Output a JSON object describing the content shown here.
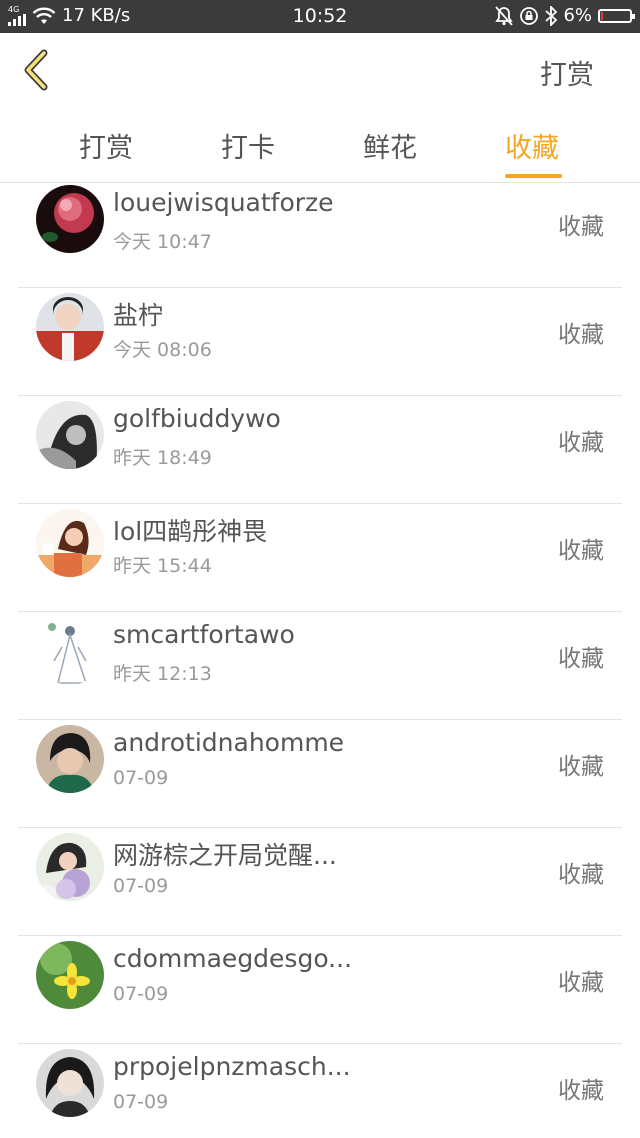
{
  "status_bar": {
    "network_type": "4G",
    "speed": "17 KB/s",
    "time": "10:52",
    "battery_text": "6%",
    "battery_level": 0.06,
    "battery_color": "#e53935"
  },
  "header": {
    "back_icon": "chevron-left-icon",
    "action_label": "打赏"
  },
  "tabs": [
    {
      "label": "打赏",
      "active": false
    },
    {
      "label": "打卡",
      "active": false
    },
    {
      "label": "鲜花",
      "active": false
    },
    {
      "label": "收藏",
      "active": true
    }
  ],
  "accent_color": "#f5a623",
  "items": [
    {
      "name": "louejwisquatforze",
      "time": "今天 10:47",
      "action": "收藏"
    },
    {
      "name": "盐柠",
      "time": "今天 08:06",
      "action": "收藏"
    },
    {
      "name": "golfbiuddywo",
      "time": "昨天 18:49",
      "action": "收藏"
    },
    {
      "name": "lol四鹋彤神畏",
      "time": "昨天 15:44",
      "action": "收藏"
    },
    {
      "name": "smcartfortawo",
      "time": "昨天 12:13",
      "action": "收藏"
    },
    {
      "name": "androtidnahomme",
      "time": "07-09",
      "action": "收藏"
    },
    {
      "name": "网游棕之开局觉醒...",
      "time": "07-09",
      "action": "收藏"
    },
    {
      "name": "cdommaegdesgo...",
      "time": "07-09",
      "action": "收藏"
    },
    {
      "name": "prpojelpnzmasch...",
      "time": "07-09",
      "action": "收藏"
    }
  ]
}
